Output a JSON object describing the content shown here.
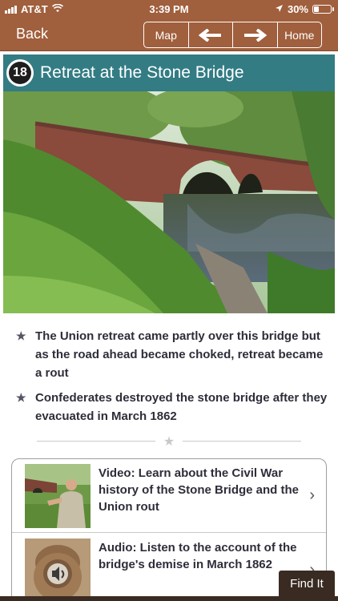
{
  "status": {
    "carrier": "AT&T",
    "time": "3:39 PM",
    "battery": "30%"
  },
  "nav": {
    "back": "Back",
    "map": "Map",
    "prev_icon": "arrow-left",
    "next_icon": "arrow-right",
    "home": "Home"
  },
  "stop": {
    "number": "18",
    "title": "Retreat at the Stone Bridge"
  },
  "bullets": [
    "The Union retreat came partly over this bridge but as the road ahead became choked, retreat became a rout",
    "Confederates destroyed the stone bridge after they evacuated in March 1862"
  ],
  "media": [
    {
      "title": "Video: Learn about the Civil War history of the Stone Bridge and the Union rout"
    },
    {
      "title": "Audio: Listen to the account of the bridge's demise in March 1862"
    }
  ],
  "find_it": "Find It",
  "colors": {
    "header": "#a05f3d",
    "title_bar": "#337c84",
    "find_it": "#3a2b22"
  }
}
